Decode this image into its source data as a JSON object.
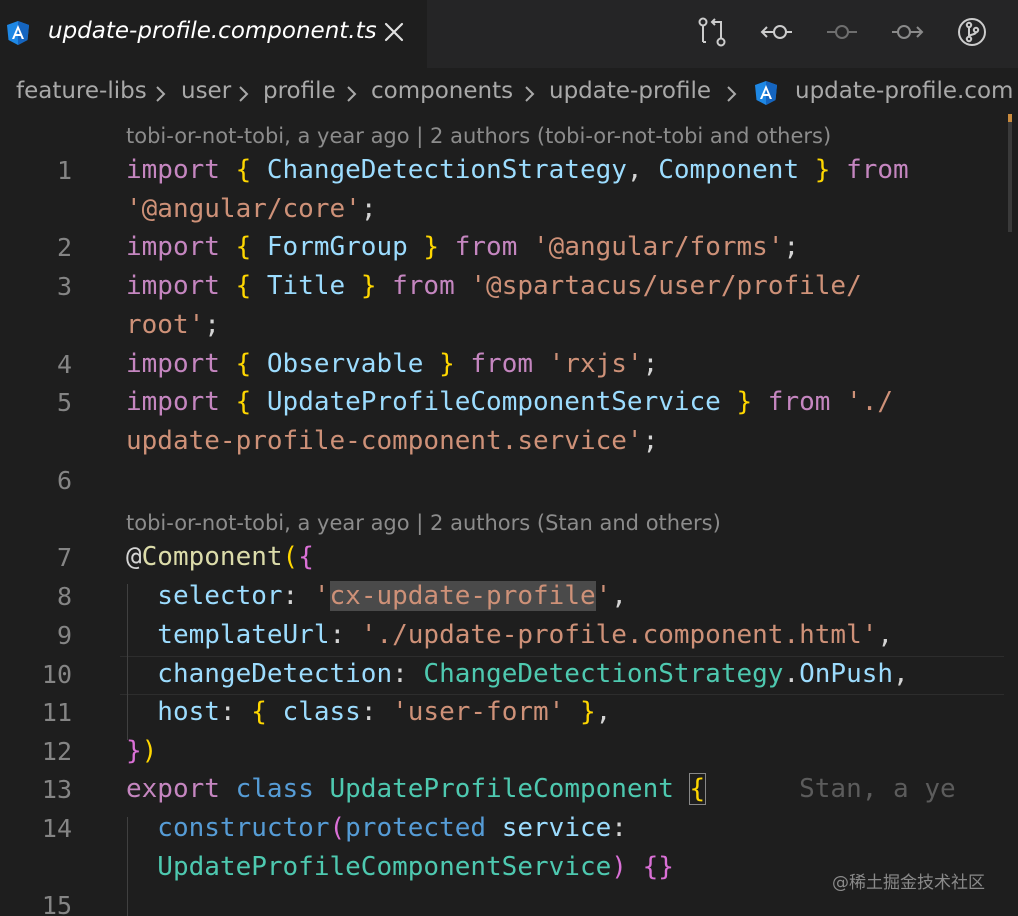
{
  "colors": {
    "background": "#1e1e1e",
    "angular_icon": "#1e88e5",
    "keyword": "#c586c0",
    "storage": "#569cd6",
    "variable": "#9cdcfe",
    "string": "#ce9178",
    "type": "#4ec9b0",
    "bracket_gold": "#ffd700",
    "bracket_orchid": "#da70d6"
  },
  "tab": {
    "title": "update-profile.component.ts",
    "icon": "angular-icon",
    "close_icon": "close-icon"
  },
  "toolbar": {
    "buttons": [
      {
        "icon": "git-compare-icon"
      },
      {
        "icon": "previous-change-icon"
      },
      {
        "icon": "current-change-icon"
      },
      {
        "icon": "next-change-icon"
      },
      {
        "icon": "git-branch-history-icon"
      }
    ]
  },
  "breadcrumb": {
    "items": [
      "feature-libs",
      "user",
      "profile",
      "components",
      "update-profile",
      "update-profile.com"
    ],
    "separator_icon": "chevron-right-icon"
  },
  "editor": {
    "blame": [
      "tobi-or-not-tobi, a year ago | 2 authors (tobi-or-not-tobi and others)",
      "tobi-or-not-tobi, a year ago | 2 authors (Stan and others)"
    ],
    "line_numbers": [
      "1",
      "2",
      "3",
      "4",
      "5",
      "6",
      "7",
      "8",
      "9",
      "10",
      "11",
      "12",
      "13",
      "14",
      "15"
    ],
    "lines": {
      "l1a": [
        {
          "t": "import",
          "c": "kw"
        },
        {
          "t": " ",
          "c": "pun"
        },
        {
          "t": "{",
          "c": "br1"
        },
        {
          "t": " ChangeDetectionStrategy",
          "c": "id"
        },
        {
          "t": ", ",
          "c": "pun"
        },
        {
          "t": "Component",
          "c": "id"
        },
        {
          "t": " ",
          "c": "pun"
        },
        {
          "t": "}",
          "c": "br1"
        },
        {
          "t": " from",
          "c": "kw"
        }
      ],
      "l1b": [
        {
          "t": "'@angular/core'",
          "c": "str"
        },
        {
          "t": ";",
          "c": "pun"
        }
      ],
      "l2": [
        {
          "t": "import",
          "c": "kw"
        },
        {
          "t": " ",
          "c": "pun"
        },
        {
          "t": "{",
          "c": "br1"
        },
        {
          "t": " FormGroup ",
          "c": "id"
        },
        {
          "t": "}",
          "c": "br1"
        },
        {
          "t": " from",
          "c": "kw"
        },
        {
          "t": " ",
          "c": "pun"
        },
        {
          "t": "'@angular/forms'",
          "c": "str"
        },
        {
          "t": ";",
          "c": "pun"
        }
      ],
      "l3a": [
        {
          "t": "import",
          "c": "kw"
        },
        {
          "t": " ",
          "c": "pun"
        },
        {
          "t": "{",
          "c": "br1"
        },
        {
          "t": " Title ",
          "c": "id"
        },
        {
          "t": "}",
          "c": "br1"
        },
        {
          "t": " from",
          "c": "kw"
        },
        {
          "t": " ",
          "c": "pun"
        },
        {
          "t": "'@spartacus/user/profile/",
          "c": "str"
        }
      ],
      "l3b": [
        {
          "t": "root'",
          "c": "str"
        },
        {
          "t": ";",
          "c": "pun"
        }
      ],
      "l4": [
        {
          "t": "import",
          "c": "kw"
        },
        {
          "t": " ",
          "c": "pun"
        },
        {
          "t": "{",
          "c": "br1"
        },
        {
          "t": " Observable ",
          "c": "id"
        },
        {
          "t": "}",
          "c": "br1"
        },
        {
          "t": " from",
          "c": "kw"
        },
        {
          "t": " ",
          "c": "pun"
        },
        {
          "t": "'rxjs'",
          "c": "str"
        },
        {
          "t": ";",
          "c": "pun"
        }
      ],
      "l5a": [
        {
          "t": "import",
          "c": "kw"
        },
        {
          "t": " ",
          "c": "pun"
        },
        {
          "t": "{",
          "c": "br1"
        },
        {
          "t": " UpdateProfileComponentService ",
          "c": "id"
        },
        {
          "t": "}",
          "c": "br1"
        },
        {
          "t": " from",
          "c": "kw"
        },
        {
          "t": " ",
          "c": "pun"
        },
        {
          "t": "'./",
          "c": "str"
        }
      ],
      "l5b": [
        {
          "t": "update-profile-component.service'",
          "c": "str"
        },
        {
          "t": ";",
          "c": "pun"
        }
      ],
      "l7": [
        {
          "t": "@",
          "c": "pun"
        },
        {
          "t": "Component",
          "c": "fn"
        },
        {
          "t": "(",
          "c": "br1"
        },
        {
          "t": "{",
          "c": "br2"
        }
      ],
      "l8": [
        {
          "t": "  selector",
          "c": "id"
        },
        {
          "t": ": ",
          "c": "pun"
        },
        {
          "t": "'",
          "c": "str"
        },
        {
          "t": "cx-update-profile",
          "c": "str hl"
        },
        {
          "t": "'",
          "c": "str"
        },
        {
          "t": ",",
          "c": "pun"
        }
      ],
      "l9": [
        {
          "t": "  templateUrl",
          "c": "id"
        },
        {
          "t": ": ",
          "c": "pun"
        },
        {
          "t": "'./update-profile.component.html'",
          "c": "str"
        },
        {
          "t": ",",
          "c": "pun"
        }
      ],
      "l10": [
        {
          "t": "  changeDetection",
          "c": "id"
        },
        {
          "t": ": ",
          "c": "pun"
        },
        {
          "t": "ChangeDetectionStrategy",
          "c": "cls"
        },
        {
          "t": ".",
          "c": "pun"
        },
        {
          "t": "OnPush",
          "c": "id"
        },
        {
          "t": ",",
          "c": "pun"
        }
      ],
      "l11": [
        {
          "t": "  host",
          "c": "id"
        },
        {
          "t": ": ",
          "c": "pun"
        },
        {
          "t": "{",
          "c": "br1"
        },
        {
          "t": " class",
          "c": "id"
        },
        {
          "t": ": ",
          "c": "pun"
        },
        {
          "t": "'user-form'",
          "c": "str"
        },
        {
          "t": " ",
          "c": "pun"
        },
        {
          "t": "}",
          "c": "br1"
        },
        {
          "t": ",",
          "c": "pun"
        }
      ],
      "l12": [
        {
          "t": "}",
          "c": "br2"
        },
        {
          "t": ")",
          "c": "br1"
        }
      ],
      "l13": [
        {
          "t": "export",
          "c": "kw"
        },
        {
          "t": " ",
          "c": "pun"
        },
        {
          "t": "class",
          "c": "kw2"
        },
        {
          "t": " ",
          "c": "pun"
        },
        {
          "t": "UpdateProfileComponent",
          "c": "cls"
        },
        {
          "t": " ",
          "c": "pun"
        },
        {
          "t": "{",
          "c": "br1 bracket-box"
        },
        {
          "t": "      Stan, a ye",
          "c": "inline-blame"
        }
      ],
      "l14a": [
        {
          "t": "  constructor",
          "c": "kw2"
        },
        {
          "t": "(",
          "c": "br2"
        },
        {
          "t": "protected",
          "c": "kw2"
        },
        {
          "t": " service",
          "c": "id"
        },
        {
          "t": ":",
          "c": "pun"
        }
      ],
      "l14b": [
        {
          "t": "  UpdateProfileComponentService",
          "c": "cls"
        },
        {
          "t": ")",
          "c": "br2"
        },
        {
          "t": " ",
          "c": "pun"
        },
        {
          "t": "{}",
          "c": "br2"
        }
      ]
    }
  },
  "watermark": "@稀土掘金技术社区"
}
